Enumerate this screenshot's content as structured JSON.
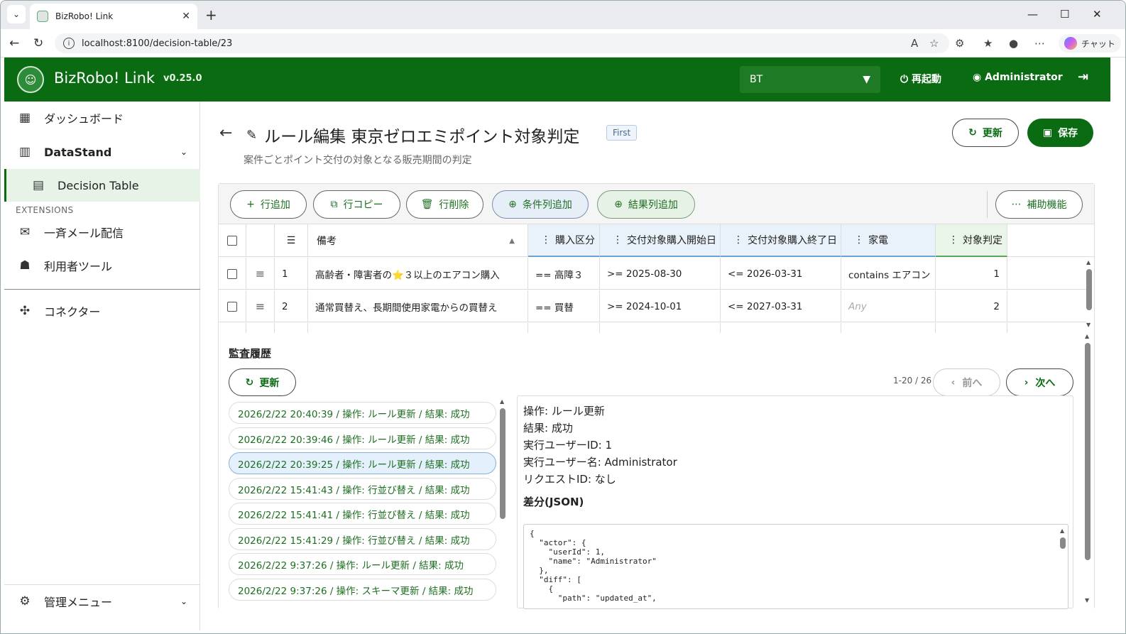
{
  "browser": {
    "tab_title": "BizRobo! Link",
    "url": "localhost:8100/decision-table/23",
    "chat_label": "チャット"
  },
  "app": {
    "brand": "BizRobo! Link",
    "version": "v0.25.0",
    "tenant": "BT",
    "restart_label": "再起動",
    "user_label": "Administrator"
  },
  "sidebar": {
    "dashboard": "ダッシュボード",
    "datastand": "DataStand",
    "decision_table": "Decision Table",
    "extensions_heading": "EXTENSIONS",
    "bulk_mail": "一斉メール配信",
    "user_tools": "利用者ツール",
    "connector": "コネクター",
    "admin_menu": "管理メニュー"
  },
  "page": {
    "title": "ルール編集 東京ゼロエミポイント対象判定",
    "badge": "First",
    "subtitle": "案件ごとポイント交付の対象となる販売期間の判定",
    "refresh_label": "更新",
    "save_label": "保存"
  },
  "toolbar": {
    "add_row": "行追加",
    "copy_row": "行コピー",
    "delete_row": "行削除",
    "add_condition": "条件列追加",
    "add_result": "結果列追加",
    "assist": "補助機能"
  },
  "table": {
    "columns": {
      "note": "備考",
      "purchase_type": "購入区分",
      "start_date": "交付対象購入開始日",
      "end_date": "交付対象購入終了日",
      "appliance": "家電",
      "result": "対象判定"
    },
    "rows": [
      {
        "no": "1",
        "note": "高齢者・障害者の⭐３以上のエアコン購入",
        "purchase_type": "== 高障３",
        "start_date": ">= 2025-08-30",
        "end_date": "<= 2026-03-31",
        "appliance": "contains エアコン",
        "result": "1"
      },
      {
        "no": "2",
        "note": "通常買替え、長期間使用家電からの買替え",
        "purchase_type": "== 買替",
        "start_date": ">= 2024-10-01",
        "end_date": "<= 2027-03-31",
        "appliance": "Any",
        "result": "2"
      }
    ]
  },
  "audit": {
    "title": "監査履歴",
    "refresh_label": "更新",
    "page_info": "1-20 / 26",
    "prev_label": "前へ",
    "next_label": "次へ",
    "items": [
      "2026/2/22 20:40:39 / 操作: ルール更新 / 結果: 成功",
      "2026/2/22 20:39:46 / 操作: ルール更新 / 結果: 成功",
      "2026/2/22 20:39:25 / 操作: ルール更新 / 結果: 成功",
      "2026/2/22 15:41:43 / 操作: 行並び替え / 結果: 成功",
      "2026/2/22 15:41:41 / 操作: 行並び替え / 結果: 成功",
      "2026/2/22 15:41:29 / 操作: 行並び替え / 結果: 成功",
      "2026/2/22 9:37:26 / 操作: ルール更新 / 結果: 成功",
      "2026/2/22 9:37:26 / 操作: スキーマ更新 / 結果: 成功"
    ],
    "detail": {
      "operation": "操作: ルール更新",
      "result": "結果: 成功",
      "user_id": "実行ユーザーID: 1",
      "user_name": "実行ユーザー名: Administrator",
      "request_id": "リクエストID: なし",
      "diff_heading": "差分(JSON)",
      "json_text": "{\n  \"actor\": {\n    \"userId\": 1,\n    \"name\": \"Administrator\"\n  },\n  \"diff\": [\n    {\n      \"path\": \"updated_at\","
    }
  },
  "colors": {
    "brand_green": "#0b6b12",
    "condition_header": "#e9f1fa",
    "result_header": "#e9f5e9"
  }
}
